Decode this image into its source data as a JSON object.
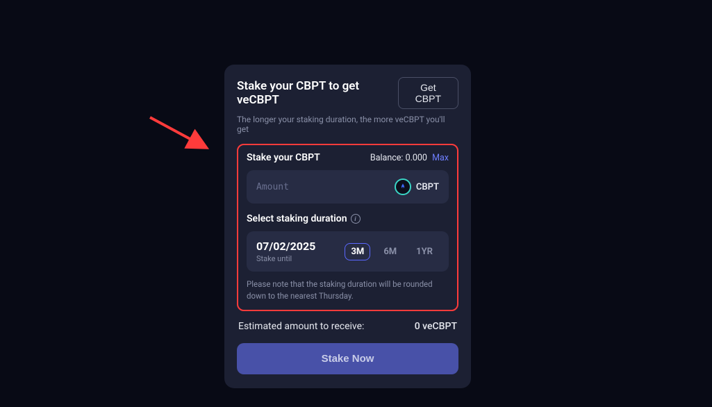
{
  "header": {
    "title": "Stake your CBPT to get veCBPT",
    "get_button": "Get CBPT",
    "subtitle": "The longer your staking duration, the more veCBPT you'll get"
  },
  "stake": {
    "label": "Stake your CBPT",
    "balance_label": "Balance:",
    "balance_value": "0.000",
    "max_label": "Max",
    "amount_placeholder": "Amount",
    "token_symbol": "CBPT"
  },
  "duration": {
    "label": "Select staking duration",
    "date": "07/02/2025",
    "date_caption": "Stake until",
    "options": [
      "3M",
      "6M",
      "1YR"
    ],
    "selected_index": 0,
    "note": "Please note that the staking duration will be rounded down to the nearest Thursday."
  },
  "estimate": {
    "label": "Estimated amount to receive:",
    "value": "0 veCBPT"
  },
  "actions": {
    "stake_now": "Stake Now"
  },
  "annotation": {
    "arrow_color": "#ff3b3b"
  }
}
